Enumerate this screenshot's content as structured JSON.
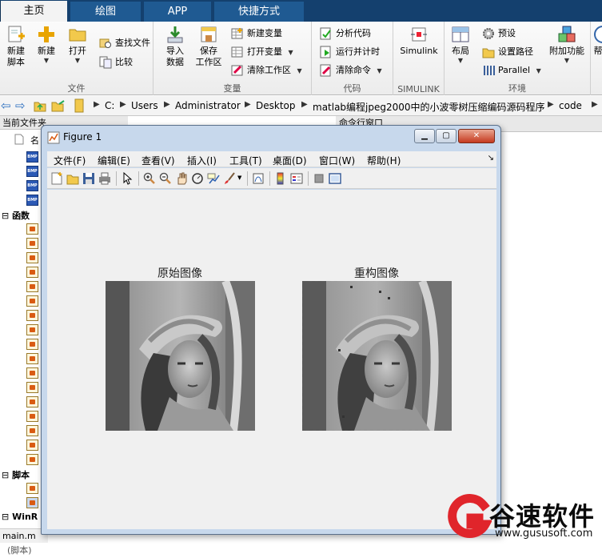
{
  "tabs": [
    {
      "label": "主页"
    },
    {
      "label": "绘图"
    },
    {
      "label": "APP"
    },
    {
      "label": "快捷方式"
    }
  ],
  "ribbon": {
    "file": {
      "title": "文件",
      "new_script": "新建\n脚本",
      "new": "新建",
      "open": "打开",
      "find_files": "查找文件",
      "compare": "比较"
    },
    "variable": {
      "title": "变量",
      "import_data": "导入\n数据",
      "save_workspace": "保存\n工作区",
      "new_variable": "新建变量",
      "open_variable": "打开变量",
      "clear_workspace": "清除工作区"
    },
    "code": {
      "title": "代码",
      "analyze": "分析代码",
      "run_time": "运行并计时",
      "clear_commands": "清除命令"
    },
    "simulink": {
      "title": "SIMULINK",
      "label": "Simulink"
    },
    "env": {
      "title": "环境",
      "layout": "布局",
      "preferences": "预设",
      "set_path": "设置路径",
      "parallel": "Parallel",
      "addons": "附加功能",
      "help_cut": "帮"
    }
  },
  "address": {
    "crumbs": [
      "C:",
      "Users",
      "Administrator",
      "Desktop",
      "matlab编程jpeg2000中的小波零树压缩编码源码程序",
      "code"
    ]
  },
  "left_panel": {
    "title": "当前文件夹",
    "col_cut": "名",
    "group_functions": "函数",
    "group_scripts": "脚本",
    "group_win_cut": "WinR",
    "status": "main.m",
    "status_cut": "(脚本)"
  },
  "right_panel": {
    "title": "命令行窗口"
  },
  "figure": {
    "title": "Figure 1",
    "menus": [
      "文件(F)",
      "编辑(E)",
      "查看(V)",
      "插入(I)",
      "工具(T)",
      "桌面(D)",
      "窗口(W)",
      "帮助(H)"
    ],
    "original_title": "原始图像",
    "reconstructed_title": "重构图像"
  },
  "watermark": {
    "brand": "谷速软件",
    "url": "www.gususoft.com",
    "logo_letter": "G"
  },
  "colors": {
    "tab_bar": "#14406e",
    "tab": "#1f5a92",
    "figure_frame": "#c7d8ec",
    "watermark_red": "#e0252b"
  }
}
